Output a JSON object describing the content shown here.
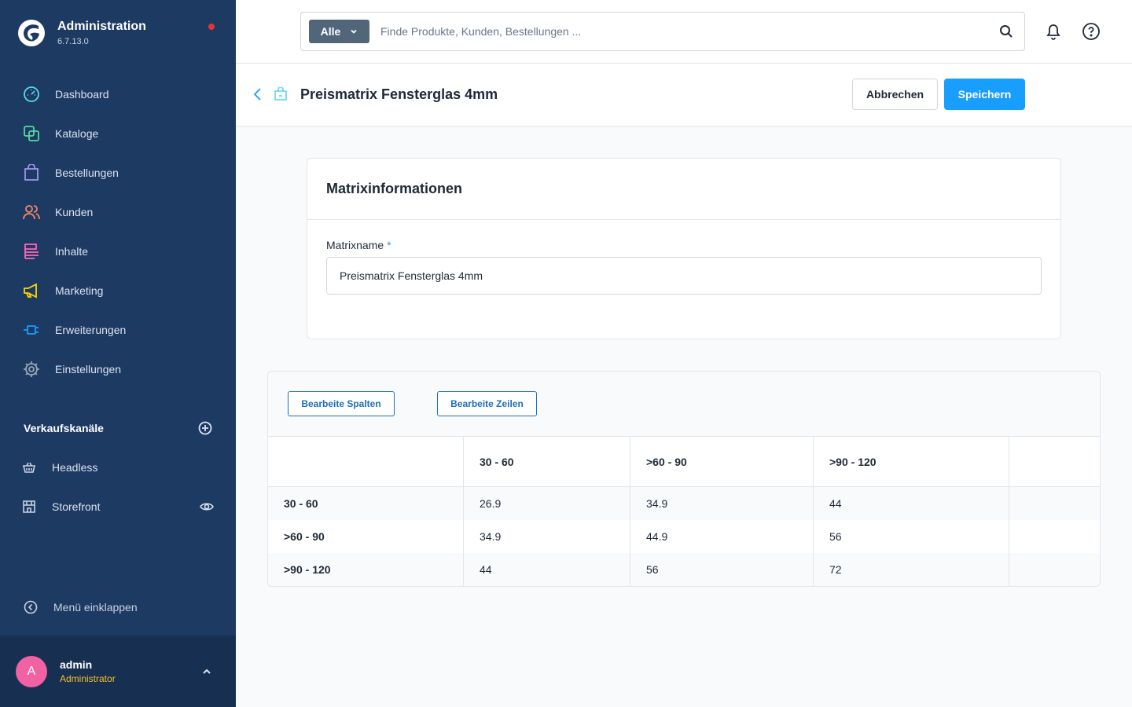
{
  "app": {
    "title": "Administration",
    "version": "6.7.13.0"
  },
  "sidebar": {
    "items": [
      {
        "label": "Dashboard",
        "icon": "dashboard-icon",
        "color": "#57d9ec"
      },
      {
        "label": "Kataloge",
        "icon": "catalog-icon",
        "color": "#57d9a3"
      },
      {
        "label": "Bestellungen",
        "icon": "shopping-bag-icon",
        "color": "#a092f0"
      },
      {
        "label": "Kunden",
        "icon": "users-icon",
        "color": "#f88962"
      },
      {
        "label": "Inhalte",
        "icon": "content-icon",
        "color": "#ff68b4"
      },
      {
        "label": "Marketing",
        "icon": "megaphone-icon",
        "color": "#ffd700"
      },
      {
        "label": "Erweiterungen",
        "icon": "plug-icon",
        "color": "#189eff"
      },
      {
        "label": "Einstellungen",
        "icon": "gear-icon",
        "color": "#9aa8b5"
      }
    ],
    "sales_channels": {
      "title": "Verkaufskanäle",
      "items": [
        {
          "label": "Headless",
          "icon": "basket-icon"
        },
        {
          "label": "Storefront",
          "icon": "storefront-icon"
        }
      ]
    },
    "collapse_label": "Menü einklappen",
    "user": {
      "initial": "A",
      "name": "admin",
      "role": "Administrator"
    }
  },
  "search": {
    "filter_label": "Alle",
    "placeholder": "Finde Produkte, Kunden, Bestellungen ..."
  },
  "page": {
    "title": "Preismatrix Fensterglas 4mm",
    "cancel_label": "Abbrechen",
    "save_label": "Speichern"
  },
  "card": {
    "title": "Matrixinformationen",
    "field_label": "Matrixname",
    "required_mark": "*",
    "field_value": "Preismatrix Fensterglas 4mm"
  },
  "matrix": {
    "edit_columns_label": "Bearbeite Spalten",
    "edit_rows_label": "Bearbeite Zeilen",
    "columns": [
      "30 - 60",
      ">60 - 90",
      ">90 - 120"
    ],
    "rows": [
      {
        "label": "30 - 60",
        "values": [
          "26.9",
          "34.9",
          "44"
        ]
      },
      {
        "label": ">60 - 90",
        "values": [
          "34.9",
          "44.9",
          "56"
        ]
      },
      {
        "label": ">90 - 120",
        "values": [
          "44",
          "56",
          "72"
        ]
      }
    ]
  },
  "colors": {
    "sidebar_bg": "#1d3a63",
    "primary": "#189eff",
    "avatar": "#f261a1",
    "role": "#f0c22d"
  }
}
